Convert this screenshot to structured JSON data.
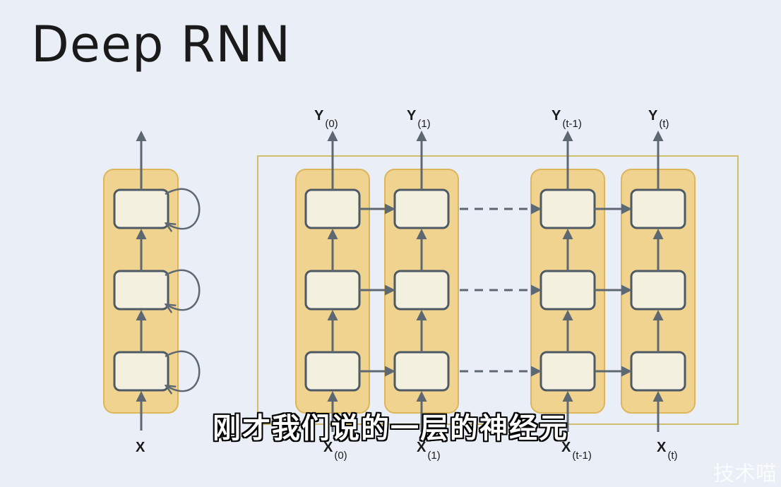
{
  "slide": {
    "title": "Deep RNN"
  },
  "diagram": {
    "folded_input_label": "X",
    "time_steps": [
      {
        "output_main": "Y",
        "output_sub": "(0)",
        "input_main": "X",
        "input_sub": "(0)"
      },
      {
        "output_main": "Y",
        "output_sub": "(1)",
        "input_main": "X",
        "input_sub": "(1)"
      },
      {
        "output_main": "Y",
        "output_sub": "(t-1)",
        "input_main": "X",
        "input_sub": "(t-1)"
      },
      {
        "output_main": "Y",
        "output_sub": "(t)",
        "input_main": "X",
        "input_sub": "(t)"
      }
    ],
    "layers": 3,
    "colors": {
      "column_fill": "#f0d38e",
      "column_stroke": "#ddb55a",
      "cell_fill": "#f3f0df",
      "cell_stroke": "#4d5a66",
      "arrow": "#5e6872",
      "frame_stroke": "#cfbe6e"
    }
  },
  "subtitle": {
    "text": "刚才我们说的一层的神经元"
  },
  "watermark": {
    "text": "技术喵"
  }
}
